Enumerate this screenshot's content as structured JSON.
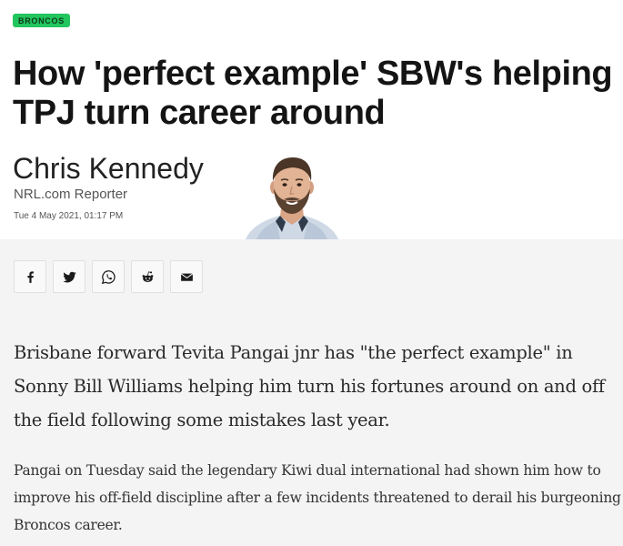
{
  "article": {
    "category": "BRONCOS",
    "headline": "How 'perfect example' SBW's helping TPJ turn career around",
    "author": {
      "name": "Chris Kennedy",
      "role": "NRL.com Reporter",
      "date": "Tue 4 May 2021, 01:17 PM"
    },
    "share_buttons": [
      {
        "name": "facebook",
        "icon": "facebook-icon"
      },
      {
        "name": "twitter",
        "icon": "twitter-icon"
      },
      {
        "name": "whatsapp",
        "icon": "whatsapp-icon"
      },
      {
        "name": "reddit",
        "icon": "reddit-icon"
      },
      {
        "name": "email",
        "icon": "email-icon"
      }
    ],
    "lead": "Brisbane forward Tevita Pangai jnr has \"the perfect example\" in Sonny Bill Williams helping him turn his fortunes around on and off the field following some mistakes last year.",
    "paragraph": "Pangai on Tuesday said the legendary Kiwi dual international had shown him how to improve his off-field discipline after a few incidents threatened to derail his burgeoning Broncos career."
  },
  "colors": {
    "badge": "#22c55e",
    "background": "#ffffff",
    "content_background": "#f4f4f4"
  }
}
